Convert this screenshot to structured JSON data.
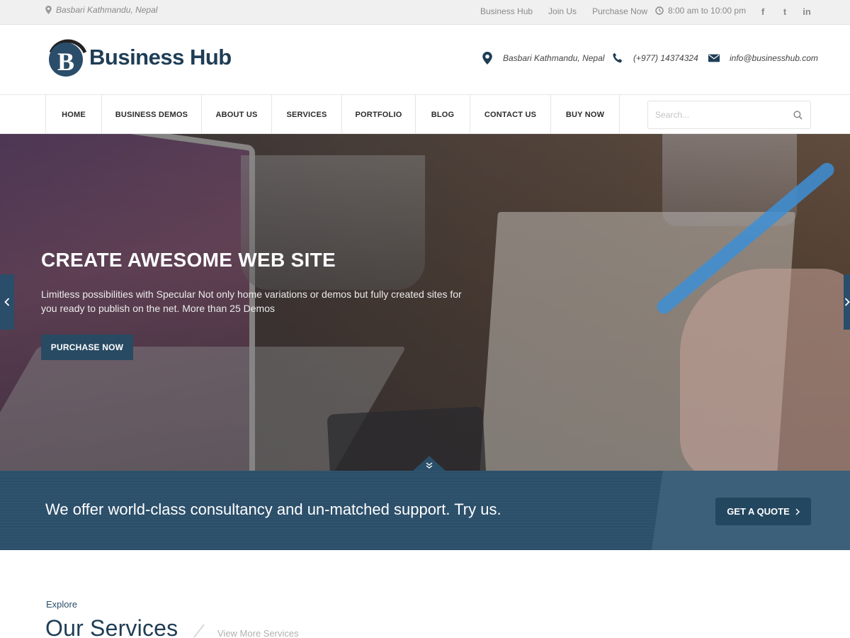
{
  "topbar": {
    "location": "Basbari Kathmandu, Nepal",
    "links": [
      "Business Hub",
      "Join Us",
      "Purchase Now"
    ],
    "hours": "8:00 am to 10:00 pm",
    "social": [
      {
        "icon": "facebook-icon",
        "glyph": "f"
      },
      {
        "icon": "twitter-icon",
        "glyph": "t"
      },
      {
        "icon": "linkedin-icon",
        "glyph": "in"
      }
    ]
  },
  "header": {
    "logo_text": "Business Hub",
    "logo_letter": "B",
    "address": "Basbari Kathmandu, Nepal",
    "phone": "(+977) 14374324",
    "email": "info@businesshub.com"
  },
  "nav": {
    "items": [
      "HOME",
      "BUSINESS DEMOS",
      "ABOUT US",
      "SERVICES",
      "PORTFOLIO",
      "BLOG",
      "CONTACT US",
      "BUY NOW"
    ],
    "search_placeholder": "Search..."
  },
  "hero": {
    "title": "CREATE AWESOME WEB SITE",
    "text": "Limitless possibilities with Specular Not only home variations or demos but fully created sites for you ready to publish on the net. More than 25 Demos",
    "button": "PURCHASE NOW"
  },
  "cta": {
    "text": "We offer world-class consultancy and un-matched support. Try us.",
    "button": "GET A QUOTE"
  },
  "services": {
    "kicker": "Explore",
    "title": "Our Services",
    "more_link": "View More Services"
  },
  "colors": {
    "brand": "#1f3d55",
    "accent": "#284a63",
    "cta_band": "#2b4e69"
  }
}
